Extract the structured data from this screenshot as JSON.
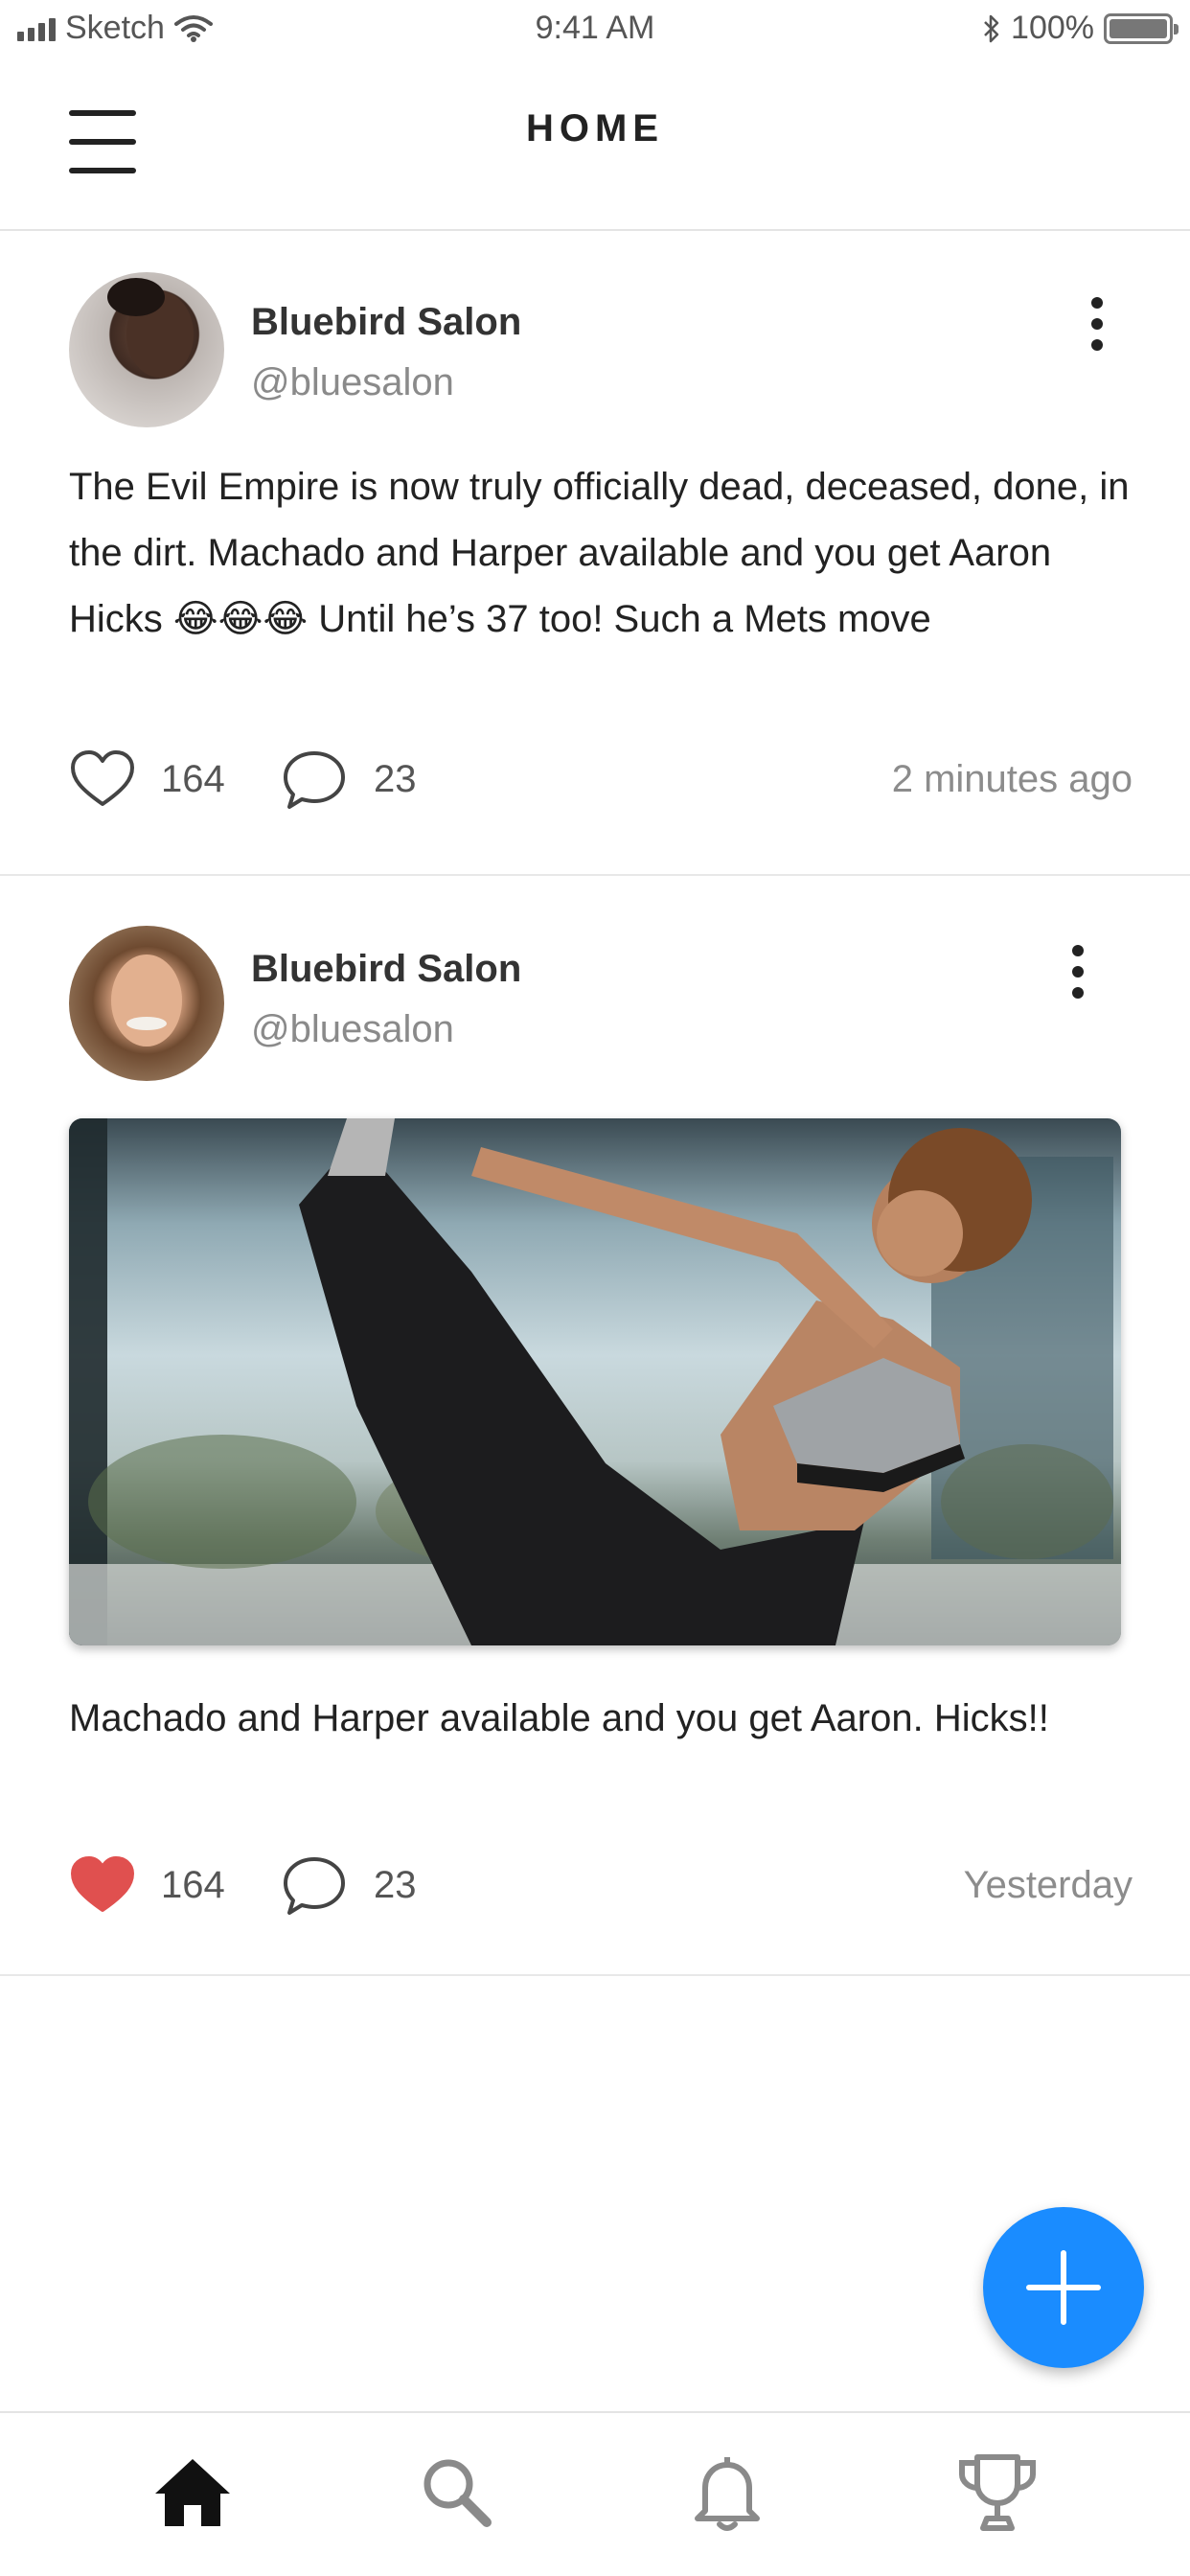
{
  "status_bar": {
    "carrier": "Sketch",
    "time": "9:41 AM",
    "battery": "100%",
    "battery_level": 1.0
  },
  "header": {
    "title": "HOME"
  },
  "posts": [
    {
      "name": "Bluebird Salon",
      "handle": "@bluesalon",
      "text": "The Evil Empire is now truly officially dead, deceased, done, in the dirt. Machado and Harper available and you get Aaron Hicks 😂😂😂 Until he’s 37 too! Such a Mets move",
      "likes": "164",
      "liked": false,
      "comments": "23",
      "time": "2 minutes ago"
    },
    {
      "name": "Bluebird Salon",
      "handle": "@bluesalon",
      "text": "Machado and Harper available and you get Aaron. Hicks!!",
      "likes": "164",
      "liked": true,
      "comments": "23",
      "time": "Yesterday",
      "has_image": true
    }
  ],
  "fab": {
    "icon": "plus-icon",
    "color": "#1a8cff"
  },
  "tab_bar": {
    "items": [
      {
        "icon": "home-icon",
        "active": true
      },
      {
        "icon": "search-icon",
        "active": false
      },
      {
        "icon": "bell-icon",
        "active": false
      },
      {
        "icon": "trophy-icon",
        "active": false
      }
    ]
  },
  "colors": {
    "accent": "#1a8cff",
    "like_active": "#e0504f",
    "text": "#222222",
    "muted": "#8a8a8a"
  }
}
